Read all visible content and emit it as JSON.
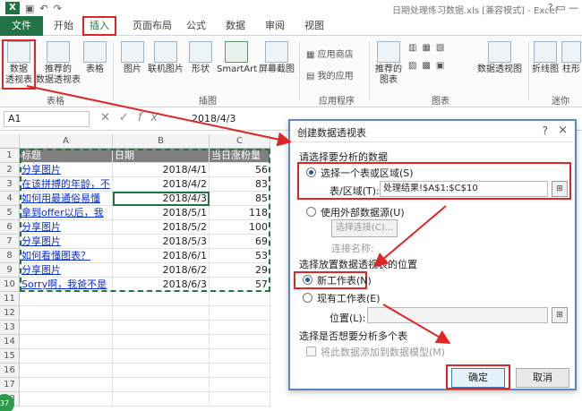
{
  "window": {
    "title": "日期处理练习数据.xls  [兼容模式] - Excel"
  },
  "tabs": {
    "file": "文件",
    "home": "开始",
    "insert": "插入",
    "layout": "页面布局",
    "formulas": "公式",
    "data": "数据",
    "review": "审阅",
    "view": "视图"
  },
  "ribbon": {
    "pivot": "数据\n透视表",
    "rec_pivot": "推荐的\n数据透视表",
    "table": "表格",
    "pictures": "图片",
    "online_pictures": "联机图片",
    "shapes": "形状",
    "smartart": "SmartArt",
    "screenshot": "屏幕截图",
    "app_store": "应用商店",
    "my_apps": "我的应用",
    "rec_charts": "推荐的\n图表",
    "pivot_chart": "数据透视图",
    "line": "折线图",
    "column": "柱形",
    "grp_tables": "表格",
    "grp_illus": "插图",
    "grp_apps": "应用程序",
    "grp_charts": "图表",
    "grp_spark": "迷你"
  },
  "formula_bar": {
    "name_box": "A1",
    "formula": "2018/4/3"
  },
  "sheet": {
    "columns": [
      "A",
      "B",
      "C"
    ],
    "rows": [
      [
        "标题",
        "日期",
        "当日涨粉量"
      ],
      [
        "分享图片",
        "2018/4/1",
        "56"
      ],
      [
        "在该拼搏的年龄，不",
        "2018/4/2",
        "83"
      ],
      [
        "如何用最通俗易懂",
        "2018/4/3",
        "85"
      ],
      [
        "拿到offer以后，我",
        "2018/5/1",
        "118"
      ],
      [
        "分享图片",
        "2018/5/2",
        "100"
      ],
      [
        "分享图片",
        "2018/5/3",
        "69"
      ],
      [
        "如何看懂图表？",
        "2018/6/1",
        "53"
      ],
      [
        "分享图片",
        "2018/6/2",
        "29"
      ],
      [
        "Sorry啊，我爸不是",
        "2018/6/3",
        "57"
      ]
    ],
    "row_numbers": [
      "1",
      "2",
      "3",
      "4",
      "5",
      "6",
      "7",
      "8",
      "9",
      "10",
      "11",
      "12",
      "13",
      "14",
      "15",
      "16",
      "17",
      "18"
    ]
  },
  "dialog": {
    "title": "创建数据透视表",
    "help": "?",
    "close": "×",
    "section1": "请选择要分析的数据",
    "opt_range": "选择一个表或区域(S)",
    "range_label": "表/区域(T):",
    "range_value": "处理结果!$A$1:$C$10",
    "opt_external": "使用外部数据源(U)",
    "choose_conn": "选择连接(C)...",
    "conn_name": "连接名称:",
    "section2": "选择放置数据透视表的位置",
    "opt_new": "新工作表(N)",
    "opt_existing": "现有工作表(E)",
    "location_label": "位置(L):",
    "section3": "选择是否想要分析多个表",
    "add_model": "将此数据添加到数据模型(M)",
    "ok": "确定",
    "cancel": "取消"
  },
  "status": {
    "badge": "37"
  }
}
